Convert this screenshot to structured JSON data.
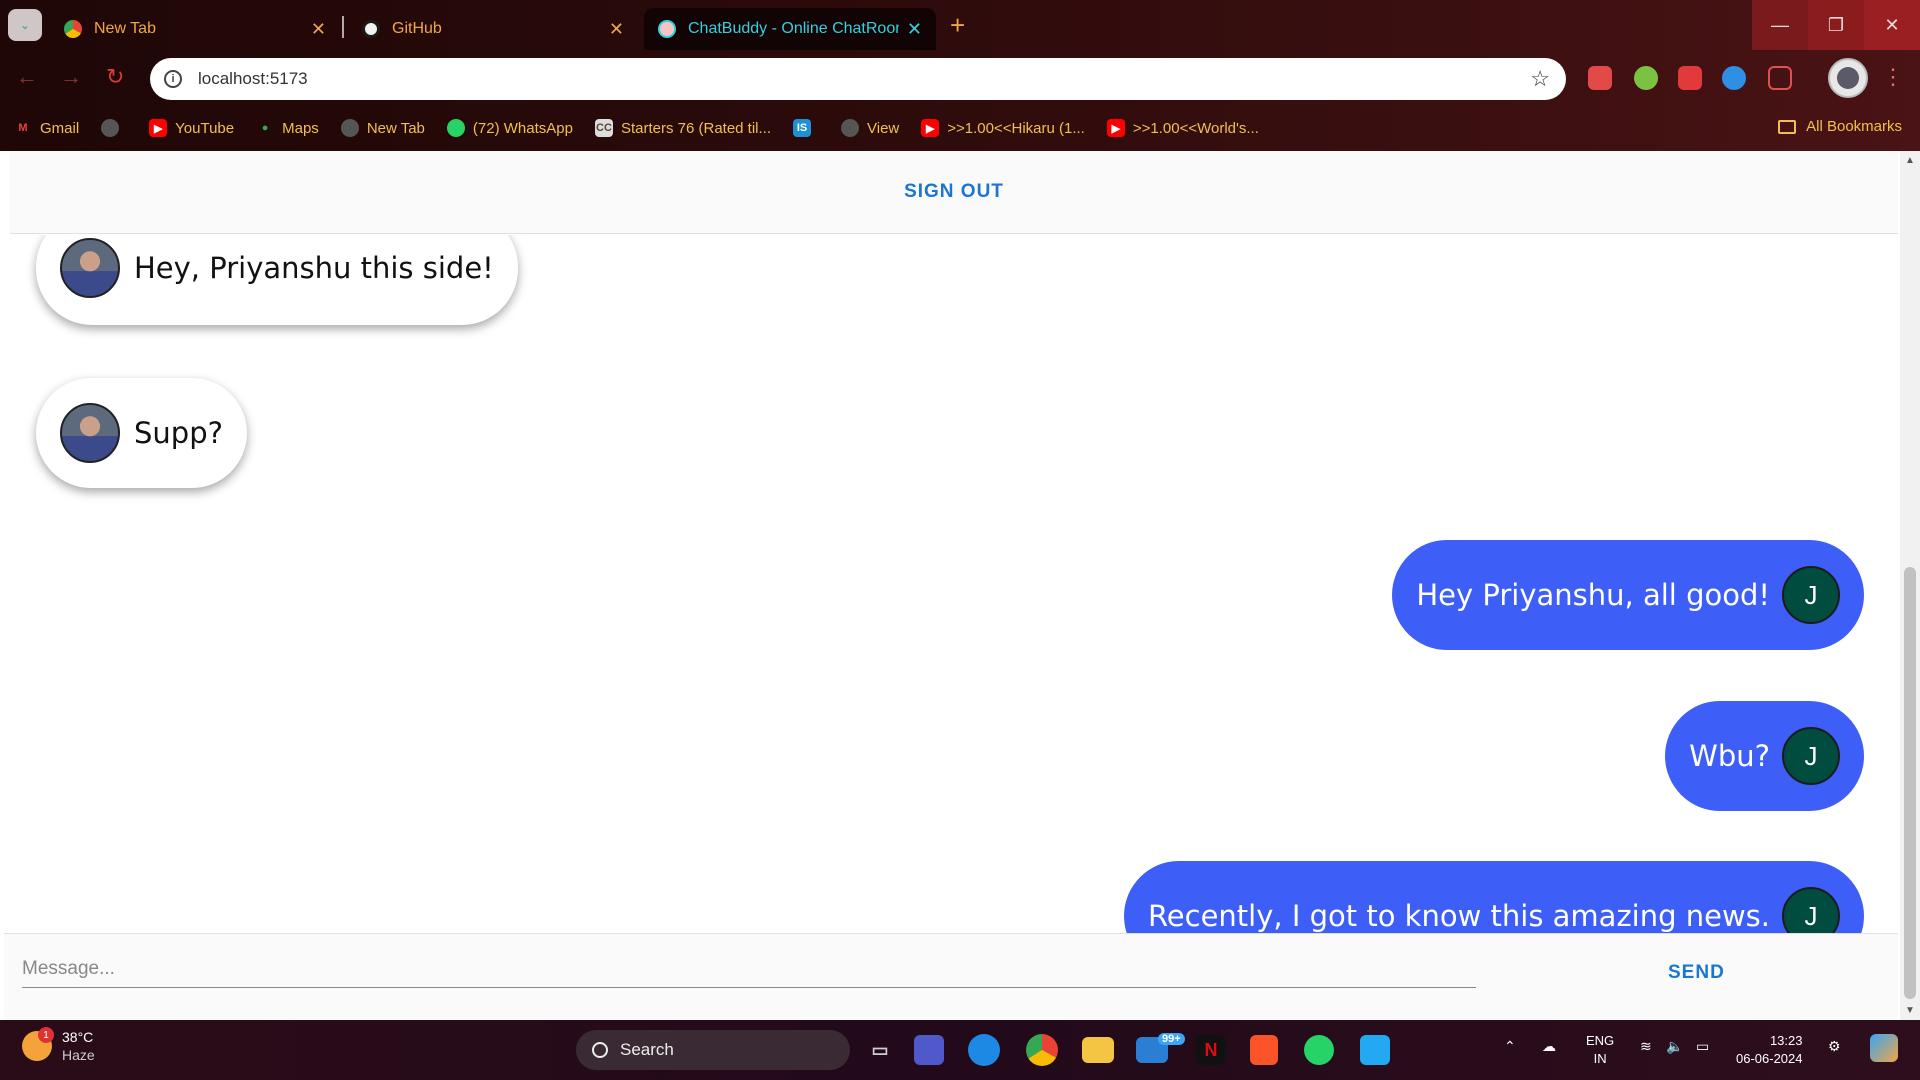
{
  "browser": {
    "tabs": [
      {
        "title": "New Tab",
        "active": false
      },
      {
        "title": "GitHub",
        "active": false
      },
      {
        "title": "ChatBuddy - Online ChatRoom",
        "active": true
      }
    ],
    "new_tab_label": "+",
    "address": "localhost:5173",
    "bookmarks": [
      {
        "label": "Gmail",
        "icon": "gmail-icon"
      },
      {
        "label": "",
        "icon": "globe-icon"
      },
      {
        "label": "YouTube",
        "icon": "youtube-icon"
      },
      {
        "label": "Maps",
        "icon": "maps-icon"
      },
      {
        "label": "New Tab",
        "icon": "globe-icon"
      },
      {
        "label": "(72) WhatsApp",
        "icon": "whatsapp-icon"
      },
      {
        "label": "Starters 76 (Rated til...",
        "icon": "codechef-icon"
      },
      {
        "label": "",
        "icon": "is-icon"
      },
      {
        "label": "View",
        "icon": "globe-icon"
      },
      {
        "label": ">>1.00<<Hikaru (1...",
        "icon": "youtube-icon"
      },
      {
        "label": ">>1.00<<World's...",
        "icon": "youtube-icon"
      }
    ],
    "all_bookmarks_label": "All Bookmarks"
  },
  "app": {
    "signout_label": "SIGN OUT",
    "messages": [
      {
        "text": "Hey, Priyanshu this side!",
        "type": "received"
      },
      {
        "text": "Supp?",
        "type": "received"
      },
      {
        "text": "Hey Priyanshu, all good!",
        "type": "sent",
        "avatar_letter": "J"
      },
      {
        "text": "Wbu?",
        "type": "sent",
        "avatar_letter": "J"
      },
      {
        "text": "Recently, I got to know this amazing news.",
        "type": "sent",
        "avatar_letter": "J"
      }
    ],
    "message_placeholder": "Message...",
    "send_label": "SEND",
    "colors": {
      "sent_bubble": "#3d5ef7",
      "avatar_bg": "#004d40",
      "button_text": "#1976d2"
    }
  },
  "taskbar": {
    "weather_temp": "38°C",
    "weather_desc": "Haze",
    "weather_badge": "1",
    "search_label": "Search",
    "mail_badge": "99+",
    "lang_top": "ENG",
    "lang_bottom": "IN",
    "time": "13:23",
    "date": "06-06-2024"
  }
}
